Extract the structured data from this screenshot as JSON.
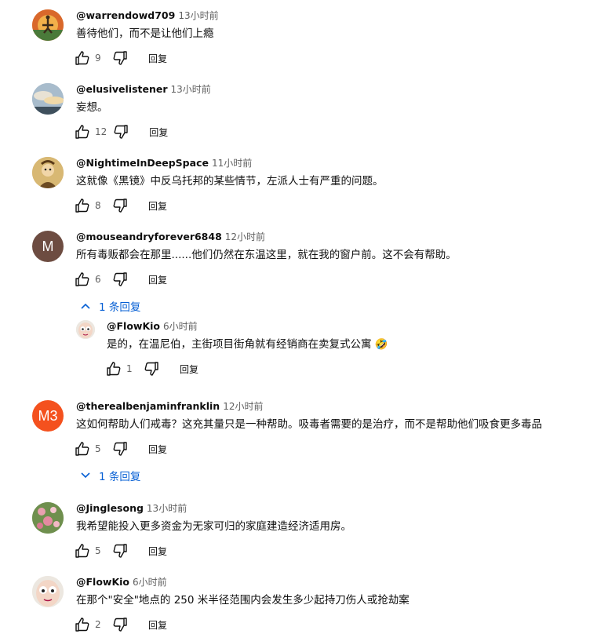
{
  "reply_label": "回复",
  "comments": [
    {
      "author": "@warrendowd709",
      "time": "13小时前",
      "text": "善待他们，而不是让他们上瘾",
      "likes": "9"
    },
    {
      "author": "@elusivelistener",
      "time": "13小时前",
      "text": "妄想。",
      "likes": "12"
    },
    {
      "author": "@NightimeInDeepSpace",
      "time": "11小时前",
      "text": "这就像《黑镜》中反乌托邦的某些情节，左派人士有严重的问题。",
      "likes": "8"
    },
    {
      "author": "@mouseandryforever6848",
      "time": "12小时前",
      "text": "所有毒贩都会在那里......他们仍然在东温这里，就在我的窗户前。这不会有帮助。",
      "likes": "6",
      "avatar_letter": "M",
      "avatar_color": "#6d4c41",
      "replies_toggle": "1 条回复"
    },
    {
      "author": "@FlowKio",
      "time": "6小时前",
      "text": "是的，在温尼伯，主街项目街角就有经销商在卖复式公寓 🤣",
      "likes": "1"
    },
    {
      "author": "@therealbenjaminfranklin",
      "time": "12小时前",
      "text": "这如何帮助人们戒毒？这充其量只是一种帮助。吸毒者需要的是治疗，而不是帮助他们吸食更多毒品",
      "likes": "5",
      "avatar_letter": "M3",
      "avatar_color": "#f4511e",
      "replies_toggle": "1 条回复"
    },
    {
      "author": "@Jinglesong",
      "time": "13小时前",
      "text": "我希望能投入更多资金为无家可归的家庭建造经济适用房。",
      "likes": "5"
    },
    {
      "author": "@FlowKio",
      "time": "6小时前",
      "text": "在那个\"安全\"地点的 250 米半径范围内会发生多少起持刀伤人或抢劫案",
      "likes": "2"
    }
  ]
}
